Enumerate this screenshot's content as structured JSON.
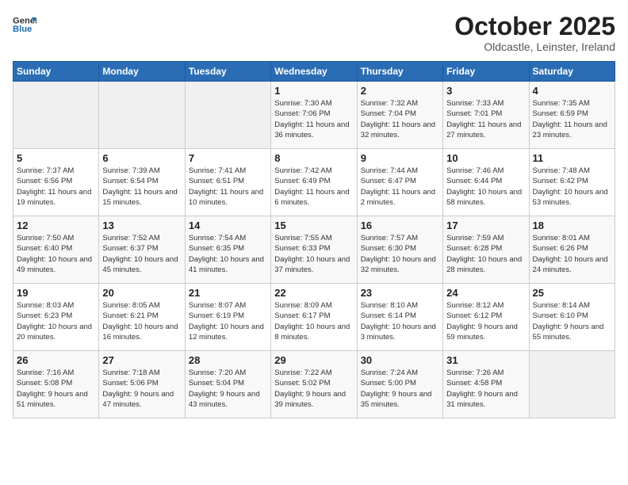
{
  "header": {
    "logo_line1": "General",
    "logo_line2": "Blue",
    "month": "October 2025",
    "location": "Oldcastle, Leinster, Ireland"
  },
  "days_of_week": [
    "Sunday",
    "Monday",
    "Tuesday",
    "Wednesday",
    "Thursday",
    "Friday",
    "Saturday"
  ],
  "weeks": [
    [
      {
        "day": "",
        "info": ""
      },
      {
        "day": "",
        "info": ""
      },
      {
        "day": "",
        "info": ""
      },
      {
        "day": "1",
        "info": "Sunrise: 7:30 AM\nSunset: 7:06 PM\nDaylight: 11 hours\nand 36 minutes."
      },
      {
        "day": "2",
        "info": "Sunrise: 7:32 AM\nSunset: 7:04 PM\nDaylight: 11 hours\nand 32 minutes."
      },
      {
        "day": "3",
        "info": "Sunrise: 7:33 AM\nSunset: 7:01 PM\nDaylight: 11 hours\nand 27 minutes."
      },
      {
        "day": "4",
        "info": "Sunrise: 7:35 AM\nSunset: 6:59 PM\nDaylight: 11 hours\nand 23 minutes."
      }
    ],
    [
      {
        "day": "5",
        "info": "Sunrise: 7:37 AM\nSunset: 6:56 PM\nDaylight: 11 hours\nand 19 minutes."
      },
      {
        "day": "6",
        "info": "Sunrise: 7:39 AM\nSunset: 6:54 PM\nDaylight: 11 hours\nand 15 minutes."
      },
      {
        "day": "7",
        "info": "Sunrise: 7:41 AM\nSunset: 6:51 PM\nDaylight: 11 hours\nand 10 minutes."
      },
      {
        "day": "8",
        "info": "Sunrise: 7:42 AM\nSunset: 6:49 PM\nDaylight: 11 hours\nand 6 minutes."
      },
      {
        "day": "9",
        "info": "Sunrise: 7:44 AM\nSunset: 6:47 PM\nDaylight: 11 hours\nand 2 minutes."
      },
      {
        "day": "10",
        "info": "Sunrise: 7:46 AM\nSunset: 6:44 PM\nDaylight: 10 hours\nand 58 minutes."
      },
      {
        "day": "11",
        "info": "Sunrise: 7:48 AM\nSunset: 6:42 PM\nDaylight: 10 hours\nand 53 minutes."
      }
    ],
    [
      {
        "day": "12",
        "info": "Sunrise: 7:50 AM\nSunset: 6:40 PM\nDaylight: 10 hours\nand 49 minutes."
      },
      {
        "day": "13",
        "info": "Sunrise: 7:52 AM\nSunset: 6:37 PM\nDaylight: 10 hours\nand 45 minutes."
      },
      {
        "day": "14",
        "info": "Sunrise: 7:54 AM\nSunset: 6:35 PM\nDaylight: 10 hours\nand 41 minutes."
      },
      {
        "day": "15",
        "info": "Sunrise: 7:55 AM\nSunset: 6:33 PM\nDaylight: 10 hours\nand 37 minutes."
      },
      {
        "day": "16",
        "info": "Sunrise: 7:57 AM\nSunset: 6:30 PM\nDaylight: 10 hours\nand 32 minutes."
      },
      {
        "day": "17",
        "info": "Sunrise: 7:59 AM\nSunset: 6:28 PM\nDaylight: 10 hours\nand 28 minutes."
      },
      {
        "day": "18",
        "info": "Sunrise: 8:01 AM\nSunset: 6:26 PM\nDaylight: 10 hours\nand 24 minutes."
      }
    ],
    [
      {
        "day": "19",
        "info": "Sunrise: 8:03 AM\nSunset: 6:23 PM\nDaylight: 10 hours\nand 20 minutes."
      },
      {
        "day": "20",
        "info": "Sunrise: 8:05 AM\nSunset: 6:21 PM\nDaylight: 10 hours\nand 16 minutes."
      },
      {
        "day": "21",
        "info": "Sunrise: 8:07 AM\nSunset: 6:19 PM\nDaylight: 10 hours\nand 12 minutes."
      },
      {
        "day": "22",
        "info": "Sunrise: 8:09 AM\nSunset: 6:17 PM\nDaylight: 10 hours\nand 8 minutes."
      },
      {
        "day": "23",
        "info": "Sunrise: 8:10 AM\nSunset: 6:14 PM\nDaylight: 10 hours\nand 3 minutes."
      },
      {
        "day": "24",
        "info": "Sunrise: 8:12 AM\nSunset: 6:12 PM\nDaylight: 9 hours\nand 59 minutes."
      },
      {
        "day": "25",
        "info": "Sunrise: 8:14 AM\nSunset: 6:10 PM\nDaylight: 9 hours\nand 55 minutes."
      }
    ],
    [
      {
        "day": "26",
        "info": "Sunrise: 7:16 AM\nSunset: 5:08 PM\nDaylight: 9 hours\nand 51 minutes."
      },
      {
        "day": "27",
        "info": "Sunrise: 7:18 AM\nSunset: 5:06 PM\nDaylight: 9 hours\nand 47 minutes."
      },
      {
        "day": "28",
        "info": "Sunrise: 7:20 AM\nSunset: 5:04 PM\nDaylight: 9 hours\nand 43 minutes."
      },
      {
        "day": "29",
        "info": "Sunrise: 7:22 AM\nSunset: 5:02 PM\nDaylight: 9 hours\nand 39 minutes."
      },
      {
        "day": "30",
        "info": "Sunrise: 7:24 AM\nSunset: 5:00 PM\nDaylight: 9 hours\nand 35 minutes."
      },
      {
        "day": "31",
        "info": "Sunrise: 7:26 AM\nSunset: 4:58 PM\nDaylight: 9 hours\nand 31 minutes."
      },
      {
        "day": "",
        "info": ""
      }
    ]
  ]
}
